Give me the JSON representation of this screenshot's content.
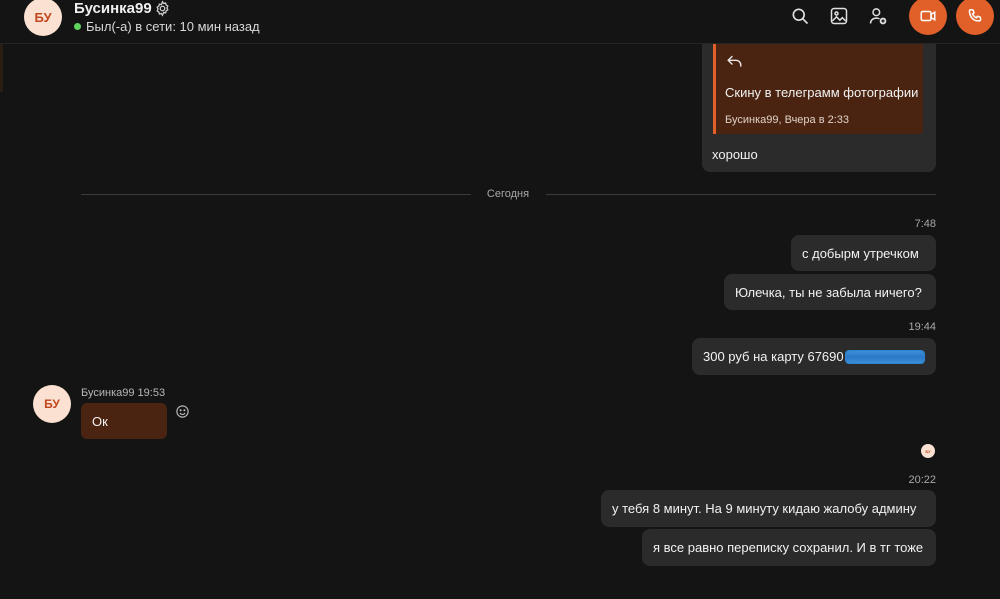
{
  "header": {
    "avatar_initials": "БУ",
    "contact_name": "Бусинка99",
    "status_text": "Был(-а) в сети: 10 мин назад",
    "icons": [
      "search-icon",
      "gallery-icon",
      "add-person-icon",
      "video-call-icon",
      "phone-call-icon"
    ]
  },
  "colors": {
    "background": "#141414",
    "bubble_out": "#2b2b2b",
    "bubble_in": "#4a2410",
    "accent": "#e1602a",
    "online": "#5fd35f"
  },
  "quoted_message": {
    "quote_text": "Скину в телеграмм фотографии",
    "quote_meta": "Бусинка99, Вчера в 2:33",
    "reply_text": "хорошо"
  },
  "date_divider": "Сегодня",
  "messages_out_1": {
    "time": "7:48",
    "items": [
      "с добырм утречком",
      "Юлечка, ты не забыла ничего?"
    ]
  },
  "messages_out_2": {
    "time": "19:44",
    "text_prefix": "300 руб на карту  6769",
    "text_visible_digit": "0"
  },
  "incoming": {
    "avatar_initials": "БУ",
    "sender_meta": "Бусинка99 19:53",
    "text": "Ок"
  },
  "read_receipt_initials": "БУ",
  "messages_out_3": {
    "time": "20:22",
    "items": [
      "у тебя 8 минут. На 9  минуту кидаю жалобу  админу",
      "я все равно переписку сохранил. И в тг тоже"
    ]
  }
}
